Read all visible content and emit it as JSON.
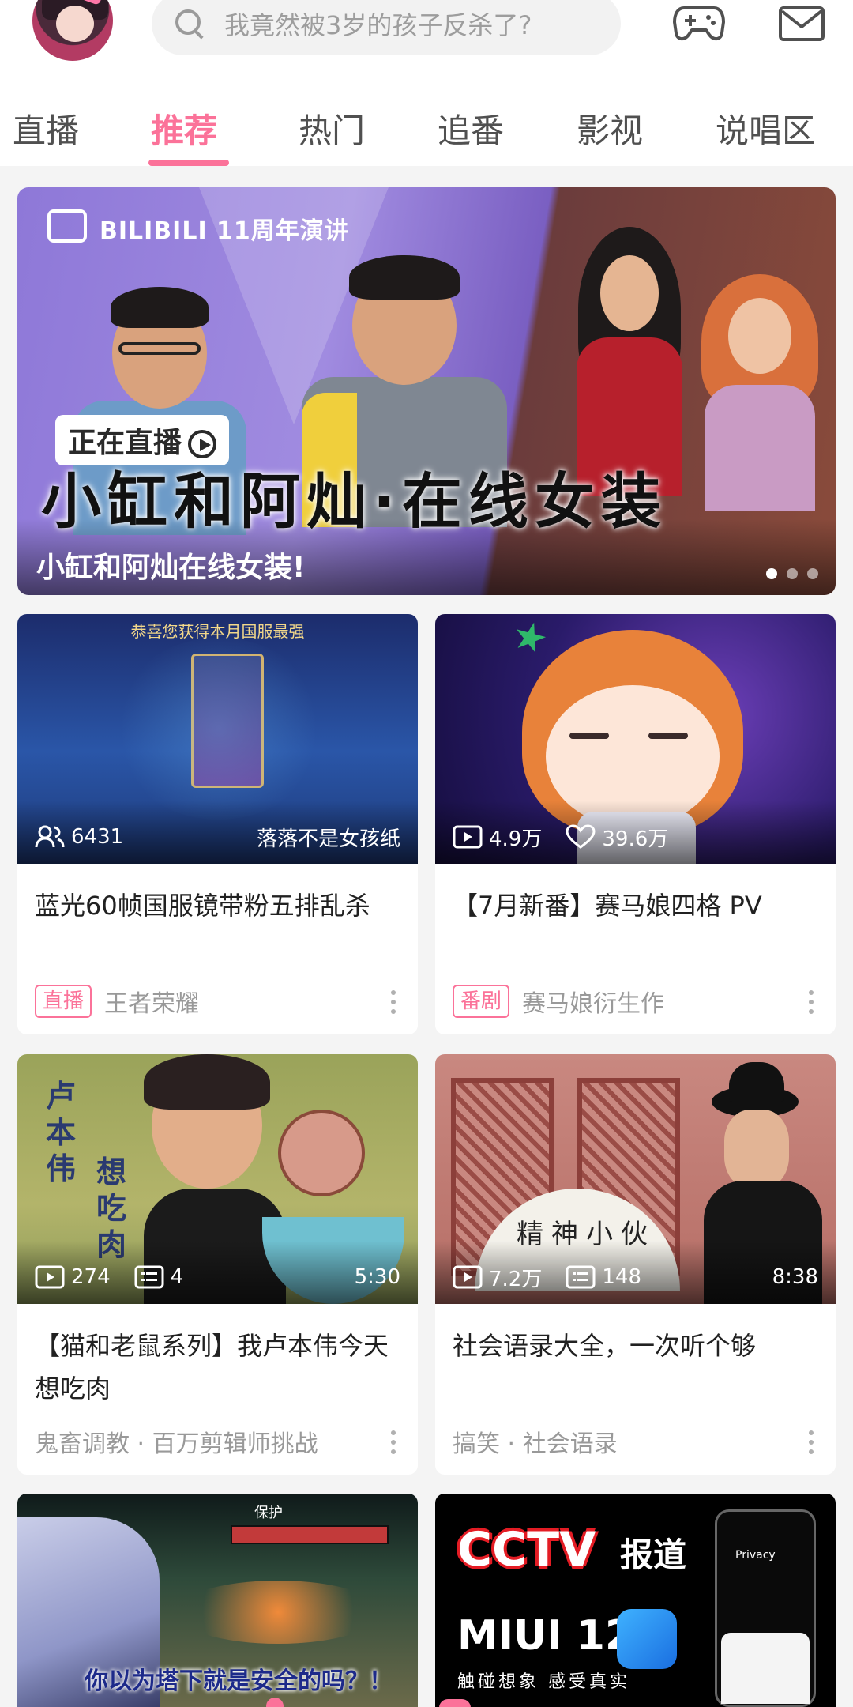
{
  "search": {
    "placeholder": "我竟然被3岁的孩子反杀了?"
  },
  "tabs": [
    "直播",
    "推荐",
    "热门",
    "追番",
    "影视",
    "说唱区"
  ],
  "active_tab": 1,
  "colors": {
    "accent": "#fb7299",
    "text": "#212121",
    "meta": "#999999",
    "background": "#f4f4f4"
  },
  "icons": {
    "search": "search-icon",
    "game": "game-controller-icon",
    "mail": "mail-icon",
    "more": "more-vertical-icon"
  },
  "banner": {
    "logo_text": "BILIBILI 11周年演讲",
    "live_badge": "正在直播",
    "headline": "小缸和阿灿·在线女装",
    "caption": "小缸和阿灿在线女装!",
    "page_count": 3,
    "active_page": 1
  },
  "cards": [
    {
      "stat1": "6431",
      "stat_right": "落落不是女孩纸",
      "title": "蓝光60帧国服镜带粉五排乱杀",
      "tag": "直播",
      "meta": "王者荣耀",
      "thumb_top_text": "恭喜您获得本月国服最强"
    },
    {
      "stat1": "4.9万",
      "stat2": "39.6万",
      "title": "【7月新番】赛马娘四格 PV",
      "tag": "番剧",
      "meta": "赛马娘衍生作"
    },
    {
      "stat1": "274",
      "stat2": "4",
      "duration": "5:30",
      "title": "【猫和老鼠系列】我卢本伟今天想吃肉",
      "meta": "鬼畜调教 · 百万剪辑师挑战",
      "thumb_text_a": "卢本伟",
      "thumb_text_b": "想吃肉"
    },
    {
      "stat1": "7.2万",
      "stat2": "148",
      "duration": "8:38",
      "title": "社会语录大全，一次听个够",
      "meta": "搞笑 · 社会语录",
      "thumb_text": "精神小伙"
    },
    {
      "thumb_text": "你以为塔下就是安全的吗？！",
      "thumb_top_label": "保护"
    },
    {
      "thumb_brand": "CCTV",
      "thumb_report": "报道",
      "thumb_product": "MIUI 12",
      "thumb_slogan": "触碰想象 感受真实",
      "thumb_phone_label": "Privacy"
    }
  ]
}
